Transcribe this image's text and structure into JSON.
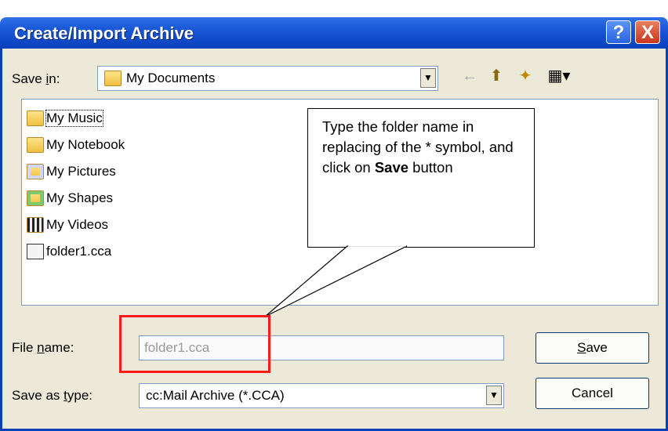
{
  "window": {
    "title": "Create/Import Archive",
    "help_glyph": "?",
    "close_glyph": "X"
  },
  "save_in": {
    "label_pre": "Save ",
    "label_u": "i",
    "label_post": "n:",
    "value": "My Documents"
  },
  "toolbar": {
    "back_glyph": "←",
    "up_glyph": "⬆",
    "new_folder_glyph": "✦",
    "view_glyph": "▦▾"
  },
  "files": [
    {
      "name": "My Music",
      "icon": "music-folder-icon"
    },
    {
      "name": "My Notebook",
      "icon": "folder-icon"
    },
    {
      "name": "My Pictures",
      "icon": "pictures-folder-icon"
    },
    {
      "name": "My Shapes",
      "icon": "shapes-folder-icon"
    },
    {
      "name": "My Videos",
      "icon": "videos-folder-icon"
    },
    {
      "name": "folder1.cca",
      "icon": "archive-file-icon"
    }
  ],
  "callout": {
    "line1": "Type the folder name in replacing of the * symbol, and click on ",
    "bold": "Save",
    "line2": " button"
  },
  "file_name": {
    "label_pre": "File ",
    "label_u": "n",
    "label_post": "ame:",
    "value": "folder1.cca"
  },
  "save_as_type": {
    "label_pre": "Save as ",
    "label_u": "t",
    "label_post": "ype:",
    "value": "cc:Mail Archive (*.CCA)"
  },
  "buttons": {
    "save_u": "S",
    "save_rest": "ave",
    "cancel": "Cancel"
  },
  "colors": {
    "highlight": "#ff1a1a",
    "title_bar": "#1757d6"
  }
}
